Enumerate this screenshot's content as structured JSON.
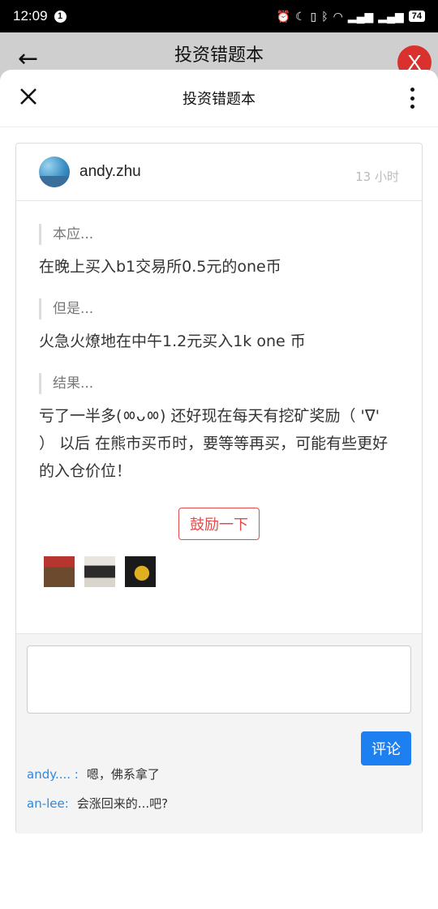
{
  "status_bar": {
    "time": "12:09",
    "notification_count": "1",
    "battery": "74"
  },
  "background_app": {
    "title": "投资错题本",
    "close_label": "X"
  },
  "sheet": {
    "title": "投资错题本"
  },
  "post": {
    "username": "andy.zhu",
    "time_ago": "13 小时",
    "sections": [
      {
        "label": "本应...",
        "text": "在晚上买入b1交易所0.5元的one币"
      },
      {
        "label": "但是...",
        "text": "火急火燎地在中午1.2元买入1k one 币"
      },
      {
        "label": "结果...",
        "text": "亏了一半多(ㆀᴗㆀ) 还好现在每天有挖矿奖励（ 'ᐁ' ） 以后 在熊市买币时，要等等再买，可能有些更好的入仓价位！"
      }
    ],
    "encourage_label": "鼓励一下"
  },
  "comment_box": {
    "placeholder": "",
    "submit_label": "评论"
  },
  "comments": [
    {
      "user": "andy.... :",
      "text": "嗯，佛系拿了"
    },
    {
      "user": "an-lee:",
      "text": "会涨回来的...吧?"
    }
  ],
  "colors": {
    "accent_blue": "#1e7ff0",
    "encourage_red": "#e24b4b",
    "link_blue": "#2f88e2"
  }
}
